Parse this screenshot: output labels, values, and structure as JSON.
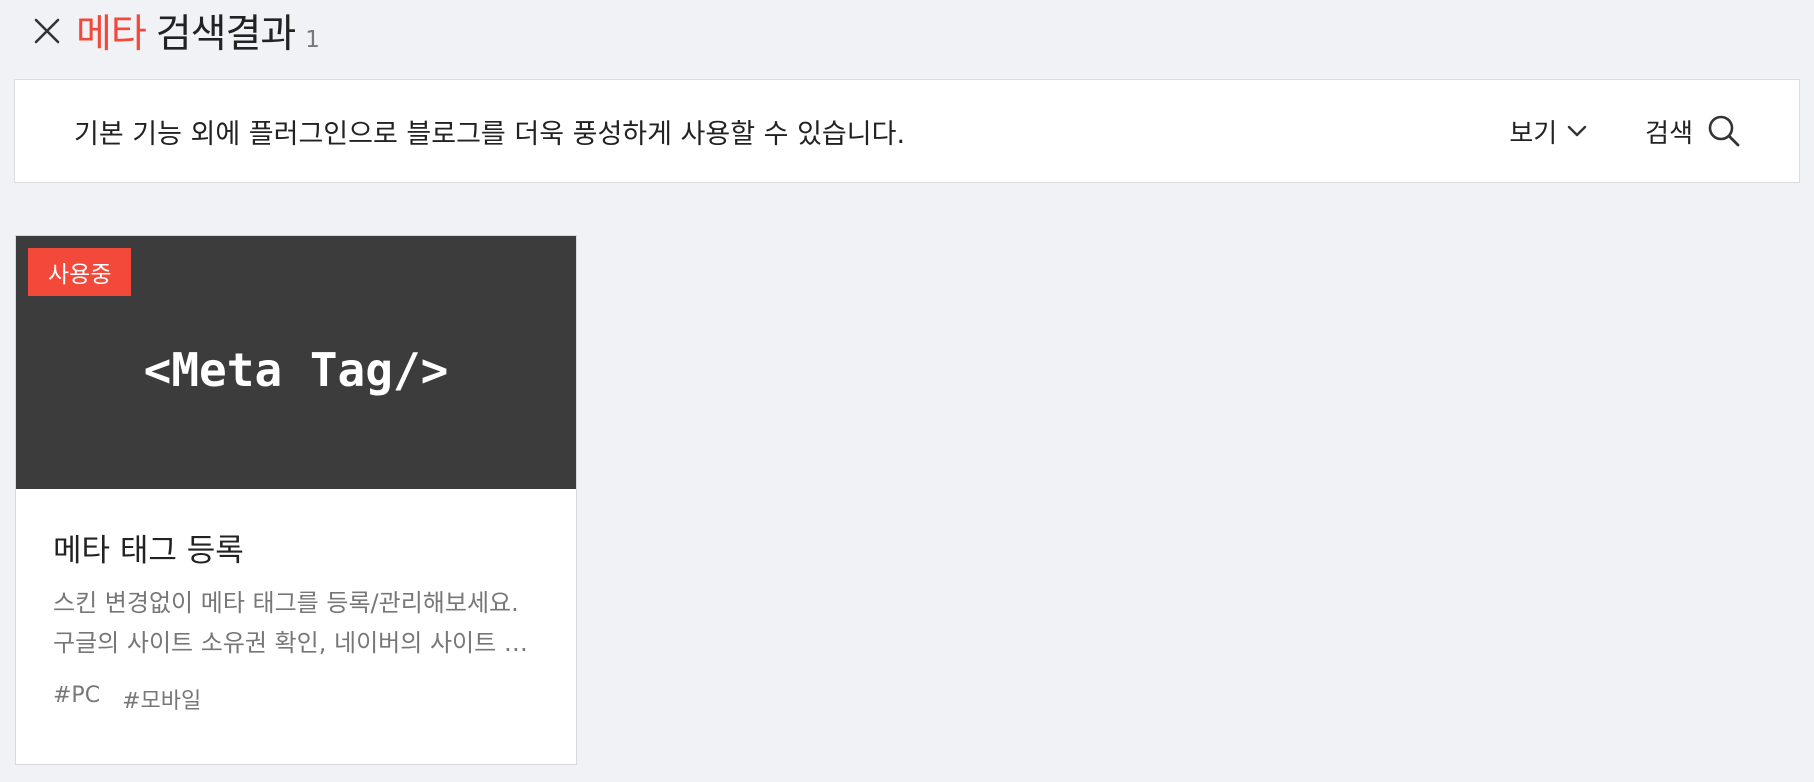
{
  "header": {
    "keyword": "메타",
    "title_rest": "검색결과",
    "count": "1",
    "close_icon": "close-icon"
  },
  "toolbar": {
    "description": "기본 기능 외에 플러그인으로 블로그를 더욱 풍성하게 사용할 수 있습니다.",
    "view_label": "보기",
    "view_icon": "chevron-down-icon",
    "search_label": "검색",
    "search_icon": "search-icon"
  },
  "results": [
    {
      "badge": "사용중",
      "thumbnail_text": "<Meta Tag/>",
      "title": "메타 태그 등록",
      "description_lines": [
        "스킨 변경없이 메타 태그를 등록/관리해보세요.",
        "구글의 사이트 소유권 확인, 네이버의 사이트 소유권 확인 등"
      ],
      "tags": [
        "#PC",
        "#모바일"
      ]
    }
  ],
  "colors": {
    "accent": "#f2493b",
    "background": "#f1f2f6",
    "thumbnail_bg": "#3c3c3c"
  }
}
